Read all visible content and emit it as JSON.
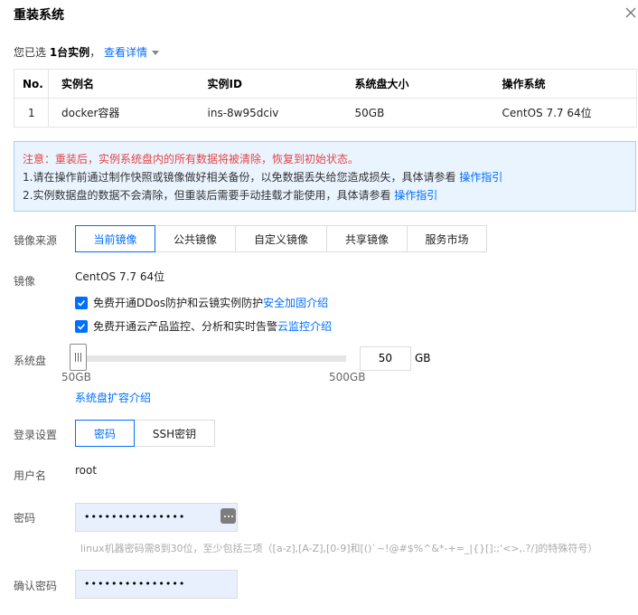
{
  "dialog": {
    "title": "重装系统",
    "close_icon": "close-icon"
  },
  "selection": {
    "prefix": "您已选 ",
    "count": "1台实例",
    "suffix": "，",
    "detail_link": "查看详情"
  },
  "table": {
    "headers": [
      "No.",
      "实例名",
      "实例ID",
      "系统盘大小",
      "操作系统"
    ],
    "rows": [
      [
        "1",
        "docker容器",
        "ins-8w95dciv",
        "50GB",
        "CentOS 7.7 64位"
      ]
    ]
  },
  "notice": {
    "warning": "注意：重装后，实例系统盘内的所有数据将被清除，恢复到初始状态。",
    "line1_text": "1.请在操作前通过制作快照或镜像做好相关备份，以免数据丢失给您造成损失，具体请参看 ",
    "line1_link": "操作指引",
    "line2_text": "2.实例数据盘的数据不会清除，但重装后需要手动挂载才能使用，具体请参看 ",
    "line2_link": "操作指引"
  },
  "image_source": {
    "label": "镜像来源",
    "options": [
      "当前镜像",
      "公共镜像",
      "自定义镜像",
      "共享镜像",
      "服务市场"
    ],
    "selected": "当前镜像"
  },
  "image": {
    "label": "镜像",
    "name": "CentOS 7.7 64位",
    "option1_text": "免费开通DDos防护和云镜实例防护 ",
    "option1_link": "安全加固介绍",
    "option1_checked": true,
    "option2_text": "免费开通云产品监控、分析和实时告警 ",
    "option2_link": "云监控介绍",
    "option2_checked": true
  },
  "system_disk": {
    "label": "系统盘",
    "min_label": "50GB",
    "max_label": "500GB",
    "min": 50,
    "max": 500,
    "value": "50",
    "unit": "GB",
    "expand_link": "系统盘扩容介绍"
  },
  "login": {
    "label": "登录设置",
    "options": [
      "密码",
      "SSH密钥"
    ],
    "selected": "密码"
  },
  "username": {
    "label": "用户名",
    "value": "root"
  },
  "password": {
    "label": "密码",
    "masked": "•••••••••••••••",
    "hint": "linux机器密码需8到30位，至少包括三项（[a-z],[A-Z],[0-9]和[()`~!@#$%^&*-+=_|{}[]:;'<>,.?/]的特殊符号）"
  },
  "confirm_password": {
    "label": "确认密码",
    "masked": "•••••••••••••••"
  },
  "colors": {
    "accent": "#006eff",
    "warning": "#e54545",
    "notice_bg": "#eaf4ff",
    "input_autofill": "#e8f0fe"
  }
}
